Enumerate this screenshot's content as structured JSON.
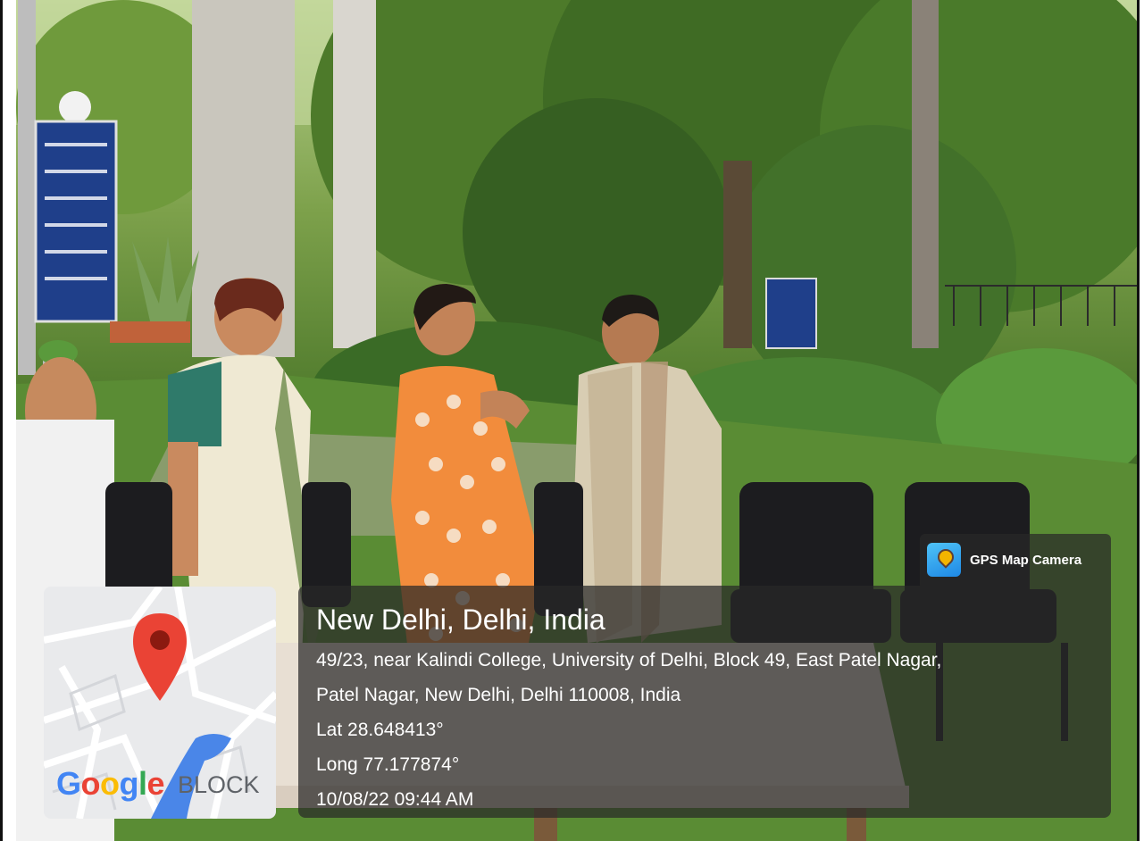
{
  "watermark": {
    "app_name": "GPS Map Camera",
    "icon": "map-pin-icon"
  },
  "location": {
    "city_line": "New Delhi, Delhi, India",
    "address_line_1": "49/23, near Kalindi College, University of Delhi, Block 49, East Patel Nagar,",
    "address_line_2": "Patel Nagar, New Delhi, Delhi 110008, India",
    "latitude": "Lat 28.648413°",
    "longitude": "Long 77.177874°",
    "timestamp": "10/08/22 09:44 AM"
  },
  "map": {
    "logo_text": "Google",
    "street_label": "BLOCK",
    "pin_color": "#ea4335"
  },
  "colors": {
    "overlay": "#282828",
    "foliage": "#4f7a2c",
    "saree_orange": "#f28c3c"
  }
}
